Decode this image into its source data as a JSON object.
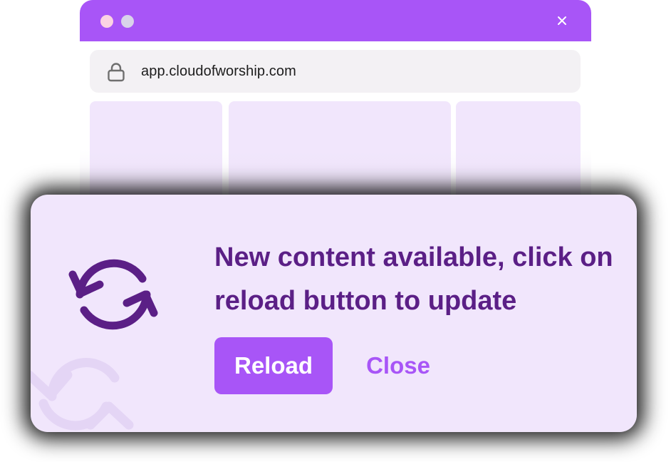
{
  "browser": {
    "url": "app.cloudofworship.com",
    "colors": {
      "titlebar": "#a855f7",
      "dot_1": "#fbd3e3",
      "dot_2": "#d9d3ea",
      "address_bg": "#f3f1f4",
      "tile": "#f1e6fc"
    },
    "icons": {
      "close": "close-icon",
      "lock": "lock-icon"
    }
  },
  "notification": {
    "message": "New content available, click on reload button to update",
    "reload_label": "Reload",
    "close_label": "Close",
    "icon": "sync-icon",
    "colors": {
      "background": "#f1e6fc",
      "text": "#5b1f86",
      "accent": "#a855f7"
    }
  }
}
